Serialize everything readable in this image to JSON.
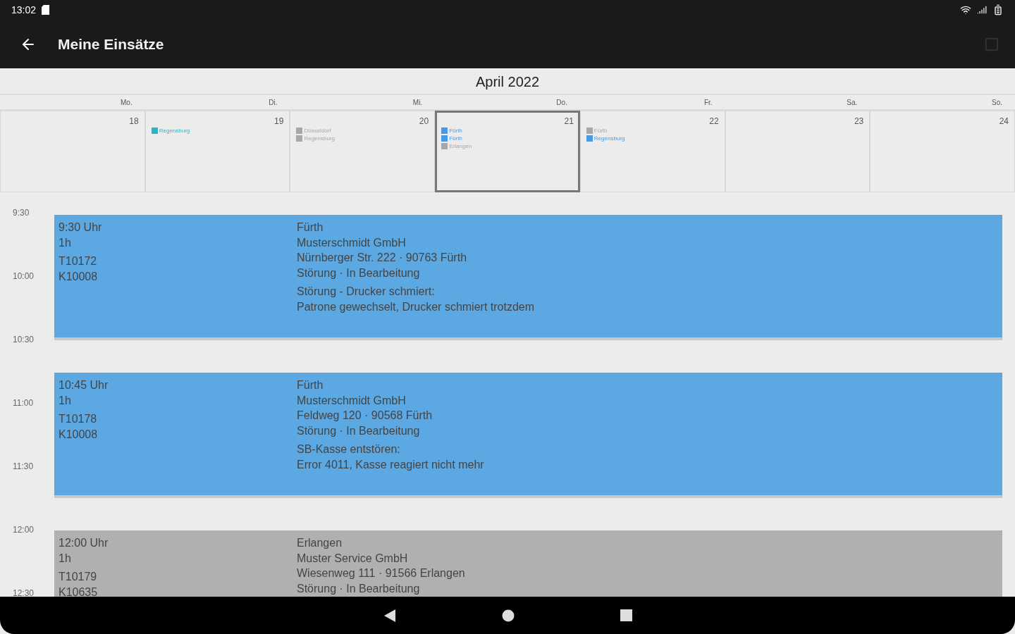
{
  "status_bar": {
    "time": "13:02"
  },
  "app_bar": {
    "title": "Meine Einsätze"
  },
  "calendar": {
    "month": "April 2022",
    "weekdays": [
      "Mo.",
      "Di.",
      "Mi.",
      "Do.",
      "Fr.",
      "Sa.",
      "So."
    ],
    "days": [
      {
        "date": "18",
        "selected": false
      },
      {
        "date": "19",
        "selected": false,
        "events": [
          {
            "label": "Regensburg",
            "color": "#26b6c4"
          }
        ]
      },
      {
        "date": "20",
        "selected": false,
        "events": [
          {
            "label": "Düsseldorf",
            "color": "#a8a8a8"
          },
          {
            "label": "Regensburg",
            "color": "#a8a8a8"
          }
        ]
      },
      {
        "date": "21",
        "selected": true,
        "events": [
          {
            "label": "Fürth",
            "color": "#4a9ae0"
          },
          {
            "label": "Fürth",
            "color": "#4a9ae0"
          },
          {
            "label": "Erlangen",
            "color": "#a8a8a8"
          }
        ]
      },
      {
        "date": "22",
        "selected": false,
        "events": [
          {
            "label": "Fürth",
            "color": "#a8a8a8"
          },
          {
            "label": "Regensburg",
            "color": "#4a9ae0"
          }
        ]
      },
      {
        "date": "23",
        "selected": false
      },
      {
        "date": "24",
        "selected": false
      }
    ]
  },
  "timeline": {
    "hours": [
      "9:30",
      "10:00",
      "10:30",
      "11:00",
      "11:30",
      "12:00",
      "12:30"
    ],
    "events": [
      {
        "color": "#5ca8e2",
        "time": "9:30 Uhr",
        "duration": "1h",
        "ticket": "T10172",
        "customer": "K10008",
        "city": "Fürth",
        "company": "Musterschmidt GmbH",
        "address": "Nürnberger Str. 222 · 90763 Fürth",
        "status": "Störung · In Bearbeitung",
        "note_title": "Störung - Drucker schmiert:",
        "note_text": "Patrone gewechselt, Drucker schmiert trotzdem"
      },
      {
        "color": "#5ca8e2",
        "time": "10:45 Uhr",
        "duration": "1h",
        "ticket": "T10178",
        "customer": "K10008",
        "city": "Fürth",
        "company": "Musterschmidt GmbH",
        "address": "Feldweg 120 · 90568 Fürth",
        "status": "Störung · In Bearbeitung",
        "note_title": "SB-Kasse entstören:",
        "note_text": "Error 4011, Kasse reagiert nicht mehr"
      },
      {
        "color": "#b0b0b0",
        "time": "12:00 Uhr",
        "duration": "1h",
        "ticket": "T10179",
        "customer": "K10635",
        "city": "Erlangen",
        "company": "Muster Service GmbH",
        "address": "Wiesenweg 111 · 91566 Erlangen",
        "status": "Störung · In Bearbeitung"
      }
    ]
  }
}
